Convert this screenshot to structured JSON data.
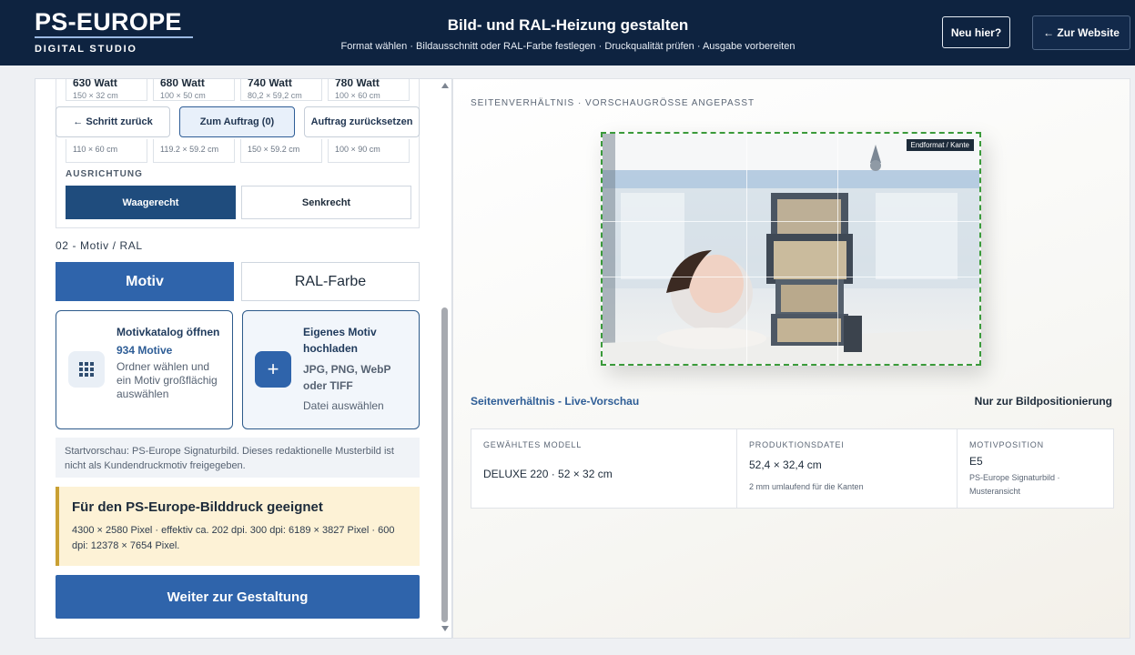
{
  "header": {
    "logo_main": "PS-EUROPE",
    "logo_sub": "DIGITAL STUDIO",
    "title": "Bild- und RAL-Heizung gestalten",
    "subtitle": "Format wählen · Bildausschnitt oder RAL-Farbe festlegen · Druckqualität prüfen · Ausgabe vorbereiten",
    "new_label": "Neu hier?",
    "website_label": "← Zur Website"
  },
  "watts": [
    {
      "value": "630 Watt",
      "size": "150 × 32 cm"
    },
    {
      "value": "680 Watt",
      "size": "100 × 50 cm"
    },
    {
      "value": "740 Watt",
      "size": "80,2 × 59,2 cm"
    },
    {
      "value": "780 Watt",
      "size": "100 × 60 cm"
    }
  ],
  "nav": {
    "back": "← Schritt zurück",
    "order": "Zum Auftrag (0)",
    "reset": "Auftrag zurücksetzen"
  },
  "dims": [
    "110 × 60 cm",
    "119.2 × 59.2 cm",
    "150 × 59.2 cm",
    "100 × 90 cm"
  ],
  "orientation": {
    "label": "AUSRICHTUNG",
    "horizontal": "Waagerecht",
    "vertical": "Senkrecht"
  },
  "section_label": "02 - Motiv / RAL",
  "tabs": {
    "motiv": "Motiv",
    "ral": "RAL-Farbe"
  },
  "catalog": {
    "title": "Motivkatalog öffnen",
    "count": "934 Motive",
    "desc": "Ordner wählen und ein Motiv großflächig auswählen",
    "icon": "grid-icon"
  },
  "upload": {
    "title": "Eigenes Motiv hochladen",
    "formats": "JPG, PNG, WebP oder TIFF",
    "desc": "Datei auswählen",
    "icon": "plus-icon"
  },
  "note": "Startvorschau: PS-Europe Signaturbild. Dieses redaktionelle Musterbild ist nicht als Kundendruckmotiv freigegeben.",
  "suitability": {
    "title": "Für den PS-Europe-Bilddruck geeignet",
    "text": "4300 × 2580 Pixel · effektiv ca. 202 dpi. 300 dpi: 6189 × 3827 Pixel · 600 dpi: 12378 × 7654 Pixel."
  },
  "cta": "Weiter zur Gestaltung",
  "preview": {
    "label": "SEITENVERHÄLTNIS · VORSCHAUGRÖSSE ANGEPASST",
    "badge": "Endformat / Kante",
    "live_label": "Seitenverhältnis - Live-Vorschau",
    "hint": "Nur zur Bildpositionierung"
  },
  "info": {
    "model_h": "GEWÄHLTES MODELL",
    "model_v": "DELUXE 220 · 52 × 32 cm",
    "file_h": "PRODUKTIONSDATEI",
    "file_v": "52,4 × 32,4 cm",
    "file_s": "2 mm umlaufend für die Kanten",
    "pos_h": "MOTIVPOSITION",
    "pos_v": "E5",
    "pos_s": "PS-Europe Signaturbild · Musteransicht"
  },
  "colors": {
    "header_bg": "#0e2340",
    "accent": "#2f64ab",
    "guide_green": "#3a9a3a",
    "warning_bar": "#c9a033"
  }
}
